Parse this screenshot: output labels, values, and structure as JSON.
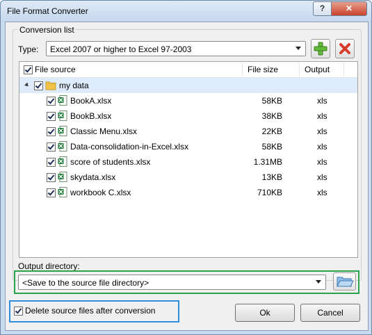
{
  "window": {
    "title": "File Format Converter",
    "help_label": "?",
    "close_label": "✕"
  },
  "conversion": {
    "group_label": "Conversion list",
    "type_label": "Type:",
    "type_value": "Excel 2007 or higher to Excel 97-2003",
    "add_icon": "green-plus-icon",
    "remove_icon": "red-x-icon"
  },
  "list": {
    "columns": {
      "file_source": "File source",
      "file_size": "File size",
      "output": "Output"
    },
    "folder": {
      "name": "my data",
      "checked": true,
      "expanded": true
    },
    "files": [
      {
        "name": "BookA.xlsx",
        "size": "58KB",
        "output": "xls",
        "checked": true
      },
      {
        "name": "BookB.xlsx",
        "size": "38KB",
        "output": "xls",
        "checked": true
      },
      {
        "name": "Classic Menu.xlsx",
        "size": "22KB",
        "output": "xls",
        "checked": true
      },
      {
        "name": "Data-consolidation-in-Excel.xlsx",
        "size": "58KB",
        "output": "xls",
        "checked": true
      },
      {
        "name": "score of students.xlsx",
        "size": "1.31MB",
        "output": "xls",
        "checked": true
      },
      {
        "name": "skydata.xlsx",
        "size": "13KB",
        "output": "xls",
        "checked": true
      },
      {
        "name": "workbook C.xlsx",
        "size": "710KB",
        "output": "xls",
        "checked": true
      }
    ]
  },
  "output": {
    "label": "Output directory:",
    "value": "<Save to the source file directory>",
    "browse_icon": "folder-open-icon"
  },
  "footer": {
    "delete_label": "Delete source files after conversion",
    "delete_checked": true,
    "ok_label": "Ok",
    "cancel_label": "Cancel"
  },
  "colors": {
    "selection": "#deebfa",
    "output_highlight": "#29a24b",
    "checkbox_highlight": "#2d8fd8",
    "excel_green": "#1f7a3a",
    "folder_yellow": "#f2c54a"
  }
}
